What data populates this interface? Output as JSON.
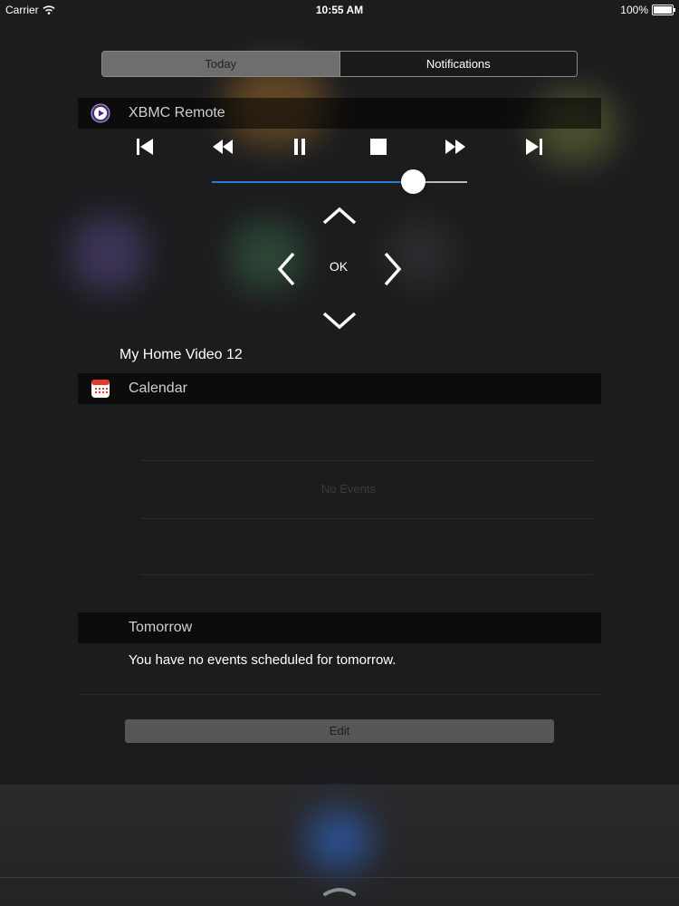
{
  "status_bar": {
    "carrier": "Carrier",
    "time": "10:55 AM",
    "battery": "100%"
  },
  "segments": {
    "today": "Today",
    "notifications": "Notifications"
  },
  "xbmc_widget": {
    "title": "XBMC Remote",
    "icon": "xbmc-icon",
    "transport_icons": [
      "skip-back-icon",
      "rewind-icon",
      "pause-icon",
      "stop-icon",
      "fast-forward-icon",
      "skip-forward-icon"
    ],
    "volume_level": 0.79,
    "ok_label": "OK",
    "now_playing": "My Home Video 12"
  },
  "calendar_widget": {
    "title": "Calendar",
    "icon": "calendar-icon",
    "no_events": "No Events",
    "tomorrow_title": "Tomorrow",
    "tomorrow_message": "You have no events scheduled for tomorrow."
  },
  "edit_label": "Edit",
  "colors": {
    "accent": "#2f7bd6",
    "background": "#1c1c1e"
  }
}
